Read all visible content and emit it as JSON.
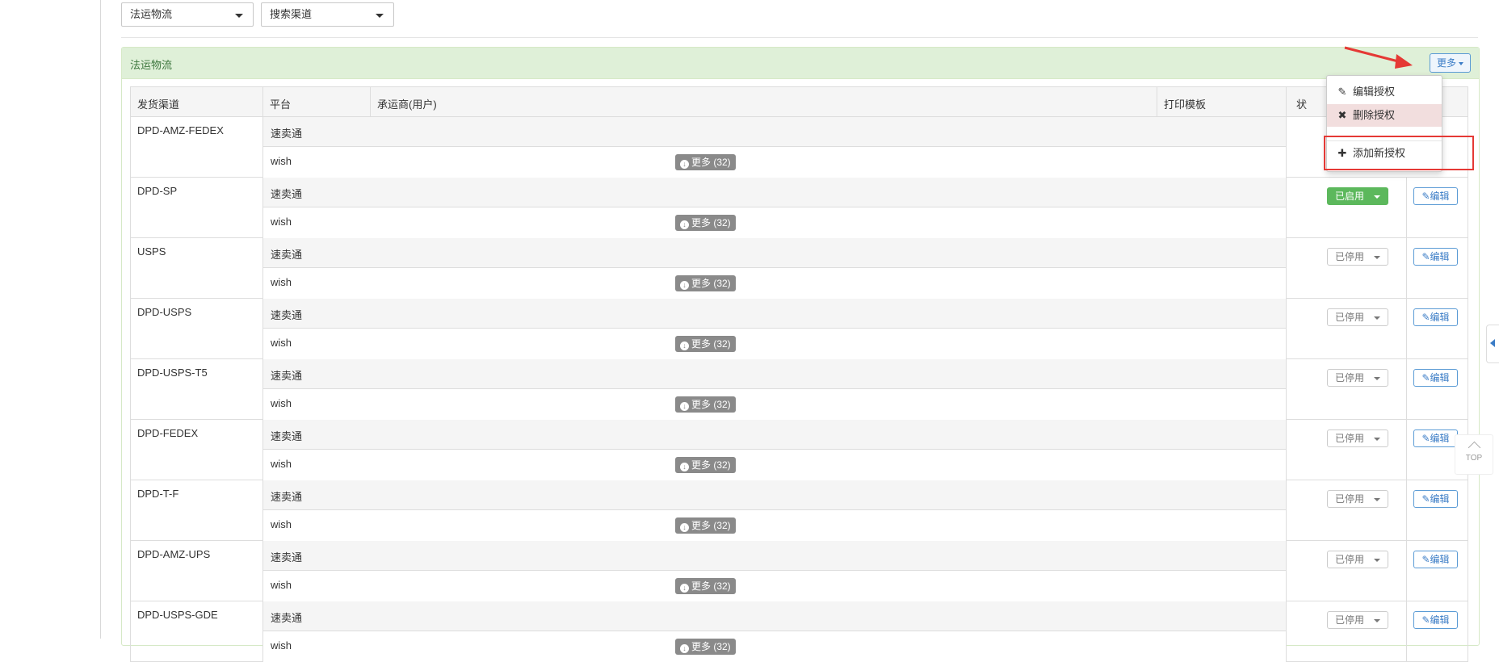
{
  "filters": {
    "logistics_select": "法运物流",
    "channel_select": "搜索渠道"
  },
  "panel": {
    "title": "法运物流",
    "more_label": "更多"
  },
  "table": {
    "headers": [
      "发货渠道",
      "平台",
      "承运商(用户)",
      "打印模板",
      "状"
    ],
    "platform_top": "速卖通",
    "platform_bottom": "wish",
    "expand_label": "更多 (32)",
    "edit_label": "编辑",
    "rows": [
      {
        "channel": "DPD-AMZ-FEDEX",
        "status": ""
      },
      {
        "channel": "DPD-SP",
        "status": "已启用"
      },
      {
        "channel": "USPS",
        "status": "已停用"
      },
      {
        "channel": "DPD-USPS",
        "status": "已停用"
      },
      {
        "channel": "DPD-USPS-T5",
        "status": "已停用"
      },
      {
        "channel": "DPD-FEDEX",
        "status": "已停用"
      },
      {
        "channel": "DPD-T-F",
        "status": "已停用"
      },
      {
        "channel": "DPD-AMZ-UPS",
        "status": "已停用"
      },
      {
        "channel": "DPD-USPS-GDE",
        "status": "已停用"
      }
    ]
  },
  "dropdown_menu": {
    "items": [
      {
        "label": "编辑授权",
        "icon": "edit-icon"
      },
      {
        "label": "删除授权",
        "icon": "close-icon"
      },
      {
        "label": "添加新授权",
        "icon": "plus-icon"
      }
    ]
  },
  "side": {
    "top_label": "TOP"
  },
  "colors": {
    "panel_heading_bg": "#dff0d8",
    "enabled_green": "#5cb85c",
    "annotation_red": "#e53935",
    "link_blue": "#3a7cc6"
  }
}
